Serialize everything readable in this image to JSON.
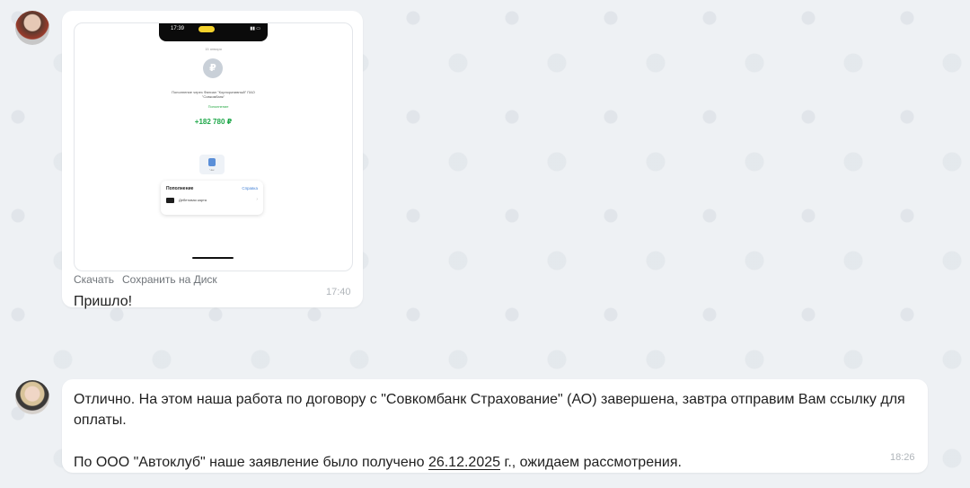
{
  "messages": [
    {
      "attachment": {
        "phone_time": "17:39",
        "date_label": "15 января",
        "operation_description": "Пополнение через Филиал \"Корпоративный\" ПАО \"Совкомбанк\"",
        "operation_tag": "Пополнение",
        "amount": "+182 780 ₽",
        "receipt_label": "Чек",
        "panel_title": "Пополнение",
        "panel_link": "Справка",
        "card_label": "Дебетовая карта"
      },
      "actions": {
        "download": "Скачать",
        "save_to_disk": "Сохранить на Диск"
      },
      "text": "Пришло!",
      "time": "17:40"
    },
    {
      "paragraph_1": "Отлично. На этом наша работа по договору с \"Совкомбанк Страхование\" (АО) завершена, завтра отправим Вам ссылку для оплаты.",
      "paragraph_2_prefix": "По ООО \"Автоклуб\" наше заявление было получено ",
      "paragraph_2_date": "26.12.2025",
      "paragraph_2_suffix": " г., ожидаем рассмотрения.",
      "time": "18:26"
    }
  ]
}
